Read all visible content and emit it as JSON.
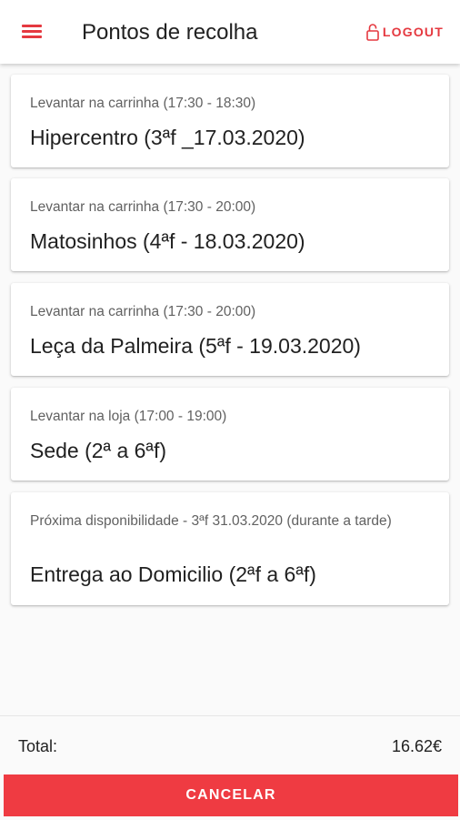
{
  "app_bar": {
    "title": "Pontos de recolha",
    "logout_label": "LOGOUT",
    "menu_icon": "menu-icon",
    "logout_icon": "lock-open-icon",
    "accent_color": "#e53940"
  },
  "pickup_points": [
    {
      "subtitle": "Levantar na carrinha (17:30 - 18:30)",
      "title": "Hipercentro (3ªf _17.03.2020)"
    },
    {
      "subtitle": "Levantar na carrinha (17:30 - 20:00)",
      "title": "Matosinhos (4ªf - 18.03.2020)"
    },
    {
      "subtitle": "Levantar na carrinha (17:30 - 20:00)",
      "title": "Leça da Palmeira (5ªf - 19.03.2020)"
    },
    {
      "subtitle": "Levantar na loja (17:00 - 19:00)",
      "title": "Sede (2ª a 6ªf)"
    },
    {
      "subtitle": "Próxima disponibilidade - 3ªf 31.03.2020 (durante a tarde)",
      "title": "Entrega ao Domicilio (2ªf a 6ªf)"
    }
  ],
  "footer": {
    "total_label": "Total:",
    "total_value": "16.62€",
    "cancel_label": "CANCELAR",
    "cancel_color": "#ef3b42"
  }
}
